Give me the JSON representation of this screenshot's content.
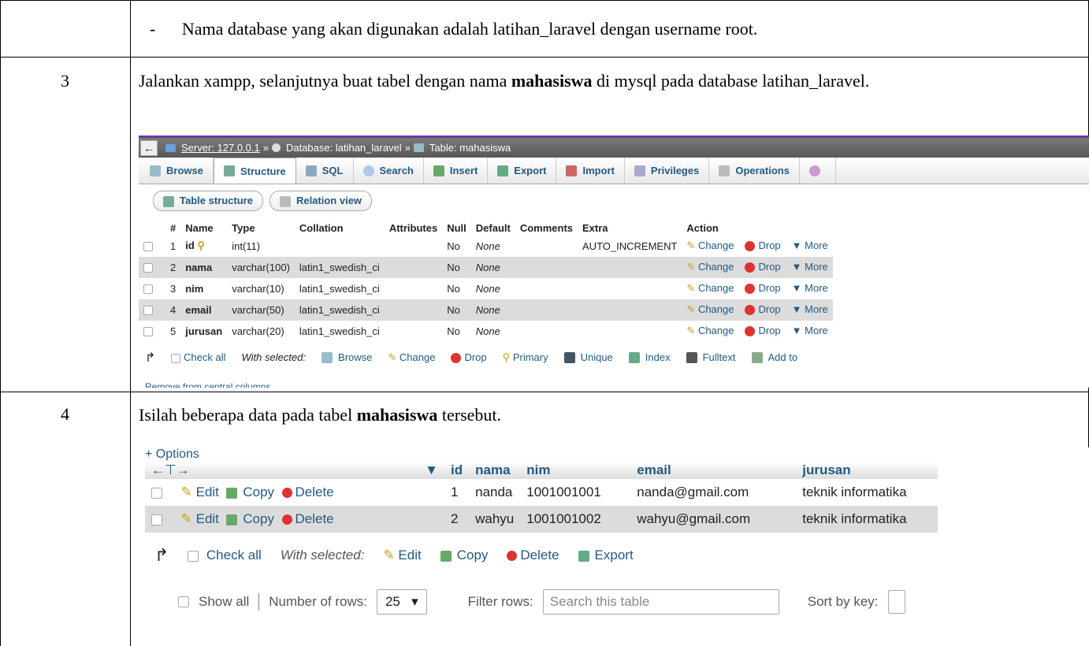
{
  "rows": [
    {
      "number": "",
      "text": "Nama database yang akan digunakan adalah latihan_laravel dengan username root.",
      "bullet": "-"
    },
    {
      "number": "3",
      "text_pre": "Jalankan xampp, selanjutnya buat tabel dengan nama ",
      "text_bold": "mahasiswa",
      "text_post": " di mysql pada database latihan_laravel."
    },
    {
      "number": "4",
      "text_pre": "Isilah beberapa data pada tabel ",
      "text_bold": "mahasiswa",
      "text_post": " tersebut."
    }
  ],
  "pma_structure": {
    "breadcrumb": {
      "server": "Server: 127.0.0.1",
      "sep": "»",
      "database": "Database: latihan_laravel",
      "table": "Table: mahasiswa"
    },
    "tabs": [
      "Browse",
      "Structure",
      "SQL",
      "Search",
      "Insert",
      "Export",
      "Import",
      "Privileges",
      "Operations"
    ],
    "subtabs": [
      "Table structure",
      "Relation view"
    ],
    "headers": [
      "#",
      "Name",
      "Type",
      "Collation",
      "Attributes",
      "Null",
      "Default",
      "Comments",
      "Extra",
      "Action"
    ],
    "columns": [
      {
        "no": "1",
        "name": "id",
        "type": "int(11)",
        "collation": "",
        "null": "No",
        "default": "None",
        "extra": "AUTO_INCREMENT"
      },
      {
        "no": "2",
        "name": "nama",
        "type": "varchar(100)",
        "collation": "latin1_swedish_ci",
        "null": "No",
        "default": "None",
        "extra": ""
      },
      {
        "no": "3",
        "name": "nim",
        "type": "varchar(10)",
        "collation": "latin1_swedish_ci",
        "null": "No",
        "default": "None",
        "extra": ""
      },
      {
        "no": "4",
        "name": "email",
        "type": "varchar(50)",
        "collation": "latin1_swedish_ci",
        "null": "No",
        "default": "None",
        "extra": ""
      },
      {
        "no": "5",
        "name": "jurusan",
        "type": "varchar(20)",
        "collation": "latin1_swedish_ci",
        "null": "No",
        "default": "None",
        "extra": ""
      }
    ],
    "actions": {
      "change": "Change",
      "drop": "Drop",
      "more": "More"
    },
    "footer": {
      "check_all": "Check all",
      "with_selected": "With selected:",
      "browse": "Browse",
      "change": "Change",
      "drop": "Drop",
      "primary": "Primary",
      "unique": "Unique",
      "index": "Index",
      "fulltext": "Fulltext",
      "add_to": "Add to",
      "remove": "Remove from central columns"
    }
  },
  "pma_browse": {
    "options": "+ Options",
    "headers": [
      "id",
      "nama",
      "nim",
      "email",
      "jurusan"
    ],
    "rows": [
      {
        "id": "1",
        "nama": "nanda",
        "nim": "1001001001",
        "email": "nanda@gmail.com",
        "jurusan": "teknik informatika"
      },
      {
        "id": "2",
        "nama": "wahyu",
        "nim": "1001001002",
        "email": "wahyu@gmail.com",
        "jurusan": "teknik informatika"
      }
    ],
    "row_actions": {
      "edit": "Edit",
      "copy": "Copy",
      "delete": "Delete"
    },
    "bulk": {
      "check_all": "Check all",
      "with_selected": "With selected:",
      "edit": "Edit",
      "copy": "Copy",
      "delete": "Delete",
      "export": "Export"
    },
    "nav": {
      "show_all": "Show all",
      "number_of_rows": "Number of rows:",
      "rows_value": "25",
      "filter_rows": "Filter rows:",
      "search_placeholder": "Search this table",
      "sort_by_key": "Sort by key:"
    }
  }
}
